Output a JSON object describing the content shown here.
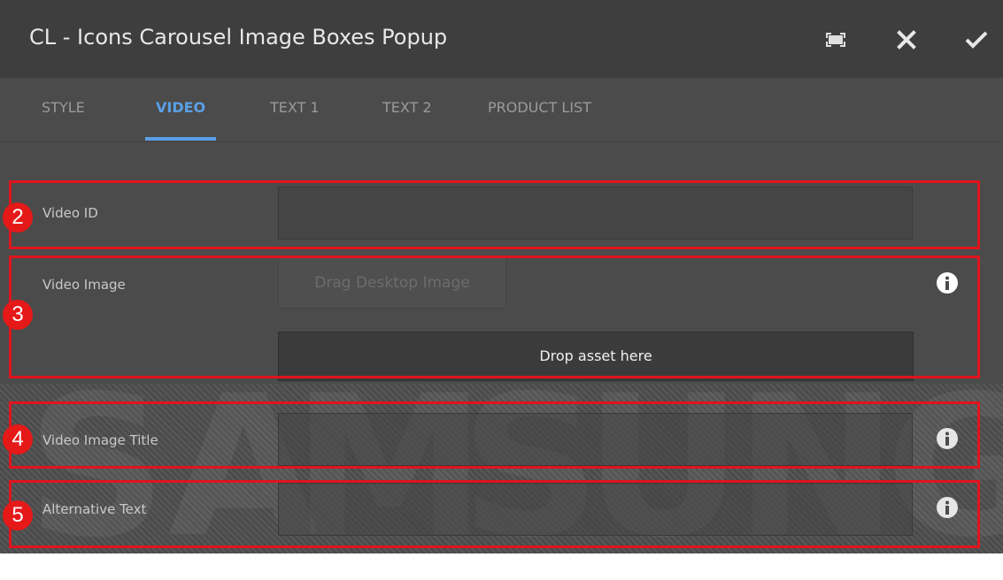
{
  "dialog": {
    "title": "CL - Icons Carousel Image Boxes Popup",
    "toolbar": {
      "fullscreen_icon": "fullscreen-icon",
      "close_icon": "close-icon",
      "confirm_icon": "checkmark-icon"
    }
  },
  "tabs": [
    {
      "label": "STYLE",
      "active": false
    },
    {
      "label": "VIDEO",
      "active": true
    },
    {
      "label": "TEXT 1",
      "active": false
    },
    {
      "label": "TEXT 2",
      "active": false
    },
    {
      "label": "PRODUCT LIST",
      "active": false
    }
  ],
  "form": {
    "video_id": {
      "label": "Video ID",
      "value": ""
    },
    "video_image": {
      "label": "Video Image",
      "drag_button": "Drag Desktop Image",
      "drop_zone": "Drop asset here"
    },
    "video_image_title": {
      "label": "Video Image Title",
      "value": ""
    },
    "alternative_text": {
      "label": "Alternative Text",
      "value": ""
    }
  },
  "annotations": [
    "2",
    "3",
    "4",
    "5"
  ],
  "watermark": [
    "S",
    "A",
    "M",
    "S",
    "U",
    "N",
    "G"
  ],
  "colors": {
    "accent": "#5aa0e6",
    "highlight": "#e0141e",
    "badge": "#e61919",
    "title_bar": "#3e3e3e",
    "panel": "#4b4b4b"
  }
}
